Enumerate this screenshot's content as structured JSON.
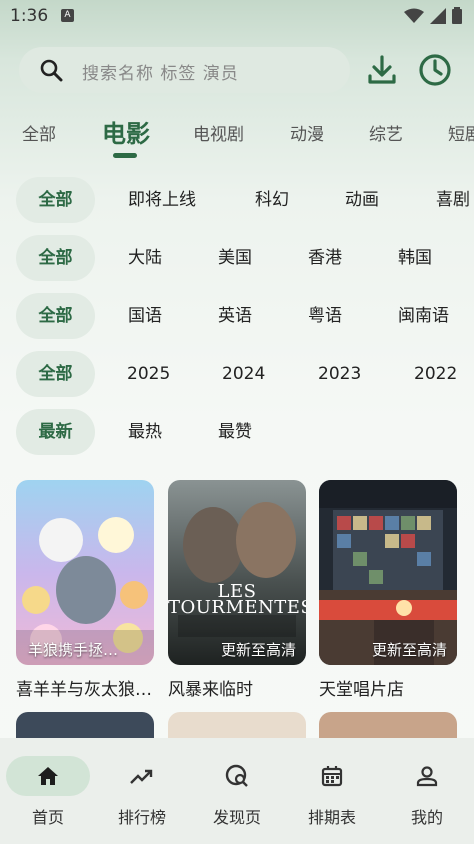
{
  "status": {
    "time": "1:36",
    "sim": "A"
  },
  "search": {
    "placeholder": "搜索名称 标签 演员"
  },
  "categories": [
    "全部",
    "电影",
    "电视剧",
    "动漫",
    "综艺",
    "短剧"
  ],
  "active_category": "电影",
  "filters": {
    "genre": [
      "全部",
      "即将上线",
      "科幻",
      "动画",
      "喜剧"
    ],
    "region": [
      "全部",
      "大陆",
      "美国",
      "香港",
      "韩国"
    ],
    "language": [
      "全部",
      "国语",
      "英语",
      "粤语",
      "闽南语"
    ],
    "year": [
      "全部",
      "2025",
      "2024",
      "2023",
      "2022"
    ],
    "sort": [
      "最新",
      "最热",
      "最赞"
    ]
  },
  "movies": [
    {
      "title": "喜羊羊与灰太狼之…",
      "badge": "羊狼携手拯…"
    },
    {
      "title": "风暴来临时",
      "badge": "更新至高清",
      "poster_text": "LES TOURMENTES"
    },
    {
      "title": "天堂唱片店",
      "badge": "更新至高清"
    }
  ],
  "bottom_nav": [
    {
      "label": "首页",
      "icon": "home-icon"
    },
    {
      "label": "排行榜",
      "icon": "trending-icon"
    },
    {
      "label": "发现页",
      "icon": "explore-icon"
    },
    {
      "label": "排期表",
      "icon": "calendar-icon"
    },
    {
      "label": "我的",
      "icon": "person-icon"
    }
  ],
  "colors": {
    "accent": "#2d6a45",
    "chip_bg": "#e2ebe4"
  }
}
